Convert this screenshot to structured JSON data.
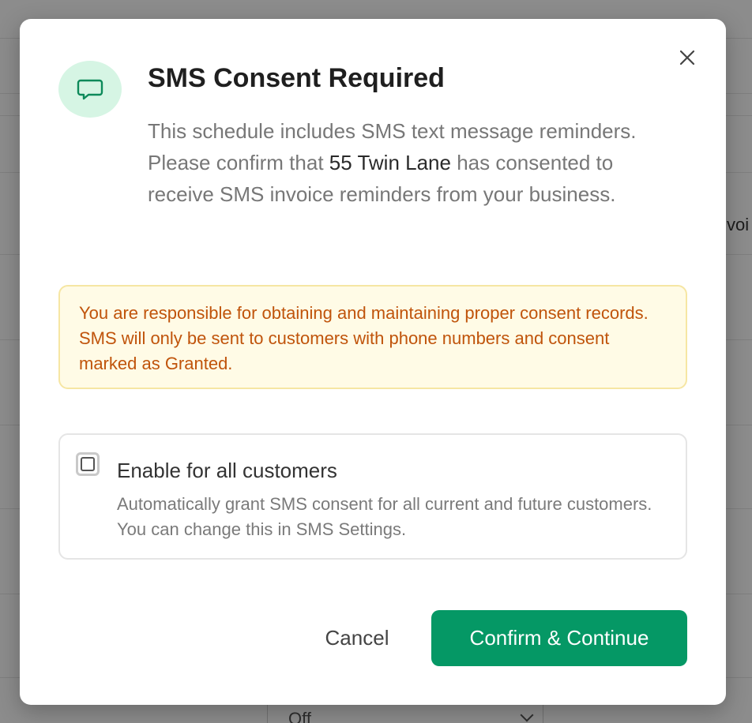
{
  "background": {
    "partial_text": "voi",
    "select_value": "Off"
  },
  "modal": {
    "title": "SMS Consent Required",
    "description": {
      "part1": "This schedule includes SMS text message reminders. Please confirm that ",
      "customer_name": "55 Twin Lane",
      "part2": " has consented to receive SMS invoice reminders from your business."
    },
    "warning": "You are responsible for obtaining and maintaining proper consent records. SMS will only be sent to customers with phone numbers and consent marked as Granted.",
    "enable_all": {
      "label": "Enable for all customers",
      "help": "Automatically grant SMS consent for all current and future customers. You can change this in SMS Settings.",
      "checked": false
    },
    "buttons": {
      "cancel": "Cancel",
      "confirm": "Confirm & Continue"
    },
    "icons": {
      "header": "message-bubble-icon",
      "close": "close-icon"
    },
    "colors": {
      "accent": "#059865",
      "icon_bg": "#d6f5e4",
      "warning_text": "#c0540b",
      "warning_bg": "#fffbe6"
    }
  }
}
